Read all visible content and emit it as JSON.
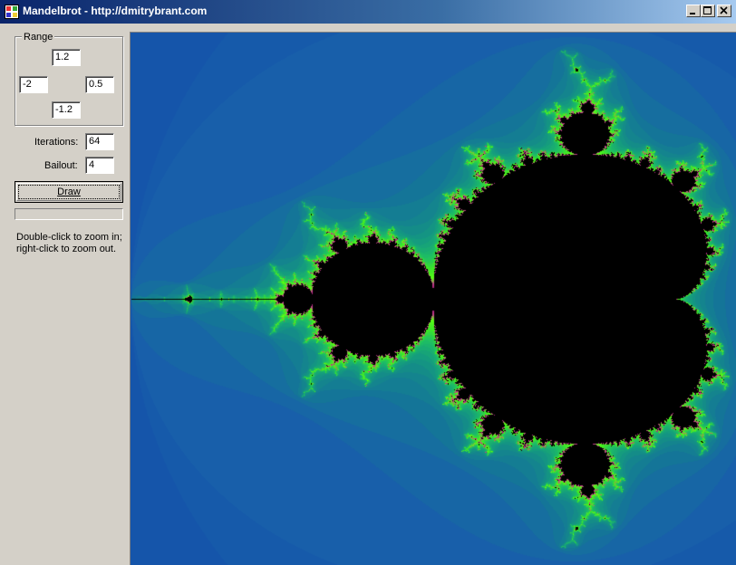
{
  "window": {
    "title": "Mandelbrot - http://dmitrybrant.com",
    "icon": "app-icon",
    "controls": {
      "minimize": "minimize-icon",
      "maximize": "maximize-icon",
      "close": "close-icon"
    }
  },
  "range": {
    "label": "Range",
    "top": "1.2",
    "left": "-2",
    "right": "0.5",
    "bottom": "-1.2"
  },
  "iterations": {
    "label": "Iterations:",
    "value": "64"
  },
  "bailout": {
    "label": "Bailout:",
    "value": "4"
  },
  "draw_button": {
    "label": "Draw"
  },
  "progress": {
    "value": 0
  },
  "help": {
    "line1": "Double-click to zoom in;",
    "line2": "right-click to zoom out."
  },
  "colors": {
    "background": "#d4d0c8",
    "titlebar_start": "#0a246a",
    "titlebar_end": "#a6caf0",
    "fractal_outer": "#1e5aa8",
    "fractal_edge": "#40ff20",
    "fractal_inside": "#000000"
  }
}
